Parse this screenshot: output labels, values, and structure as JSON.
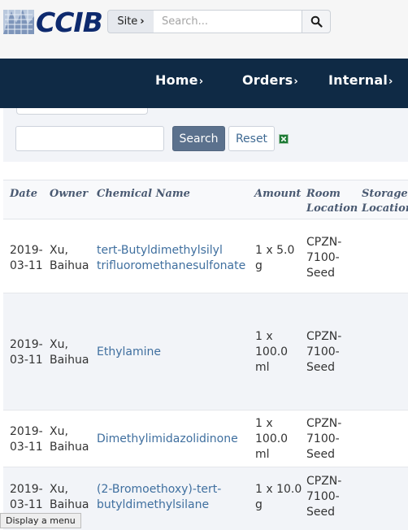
{
  "header": {
    "logo_text": "CCIB",
    "site_label": "Site",
    "site_chevron": "›",
    "search_placeholder": "Search..."
  },
  "nav": {
    "items": [
      {
        "label": "Home",
        "chevron": "›"
      },
      {
        "label": "Orders",
        "chevron": "›"
      },
      {
        "label": "Internal",
        "chevron": "›"
      }
    ]
  },
  "filter": {
    "search_label": "Search",
    "reset_label": "Reset"
  },
  "table": {
    "headers": [
      "Date",
      "Owner",
      "Chemical Name",
      "Amount",
      "Room Location",
      "Storage Location"
    ],
    "header_lines": {
      "room": [
        "Room",
        "Location"
      ],
      "storage": [
        "Storage",
        "Location"
      ]
    },
    "rows": [
      {
        "date": [
          "2019-",
          "03-11"
        ],
        "owner": [
          "Xu,",
          "Baihua"
        ],
        "chemical": [
          "tert-Butyldimethylsilyl",
          "trifluoromethanesulfonate"
        ],
        "amount": [
          "1 x 5.0",
          "g"
        ],
        "room": [
          "CPZN-",
          "7100-",
          "Seed"
        ]
      },
      {
        "date": [
          "2019-",
          "03-11"
        ],
        "owner": [
          "Xu,",
          "Baihua"
        ],
        "chemical": [
          "Ethylamine"
        ],
        "amount": [
          "1 x",
          "100.0",
          "ml"
        ],
        "room": [
          "CPZN-",
          "7100-",
          "Seed"
        ]
      },
      {
        "date": [
          "2019-",
          "03-11"
        ],
        "owner": [
          "Xu,",
          "Baihua"
        ],
        "chemical": [
          "Dimethylimidazolidinone"
        ],
        "amount": [
          "1 x",
          "100.0",
          "ml"
        ],
        "room": [
          "CPZN-",
          "7100-",
          "Seed"
        ]
      },
      {
        "date": [
          "2019-",
          "03-11"
        ],
        "owner": [
          "Xu,",
          "Baihua"
        ],
        "chemical": [
          "(2-Bromoethoxy)-tert-",
          "butyldimethylsilane"
        ],
        "amount": [
          "1 x 10.0",
          "g"
        ],
        "room": [
          "CPZN-",
          "7100-",
          "Seed"
        ]
      }
    ]
  },
  "tooltip": "Display a menu",
  "colors": {
    "nav_bg": "#0f2a45",
    "link": "#3f6f9f",
    "primary_button": "#5b718d"
  }
}
